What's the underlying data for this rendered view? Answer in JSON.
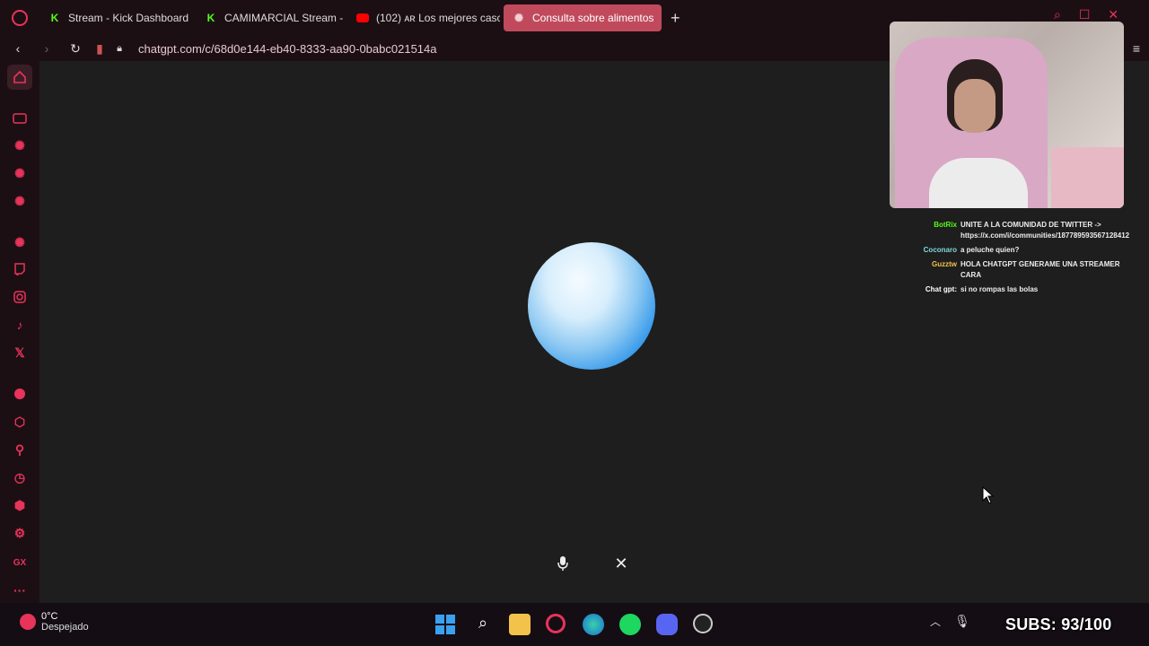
{
  "browser": {
    "tabs": [
      {
        "label": "Stream - Kick Dashboard",
        "type": "kick"
      },
      {
        "label": "CAMIMARCIAL Stream - \\",
        "type": "kick"
      },
      {
        "label": "(102) ᴀʀ Los mejores casc",
        "type": "youtube"
      },
      {
        "label": "Consulta sobre alimentos",
        "type": "chatgpt",
        "active": true
      }
    ],
    "new_tab_label": "+",
    "url": "chatgpt.com/c/68d0e144-eb40-8333-aa90-0babc021514a",
    "accent_color": "#e8335a"
  },
  "sidebar": {
    "icons": [
      "home-icon",
      "game-controller-icon",
      "chatgpt-icon",
      "chatgpt-icon",
      "chatgpt-icon",
      "chatgpt-icon",
      "twitch-icon",
      "instagram-icon",
      "tiktok-icon",
      "x-icon",
      "record-icon",
      "cube-icon",
      "pin-icon",
      "clock-icon",
      "box-icon",
      "settings-icon",
      "gx-icon",
      "more-icon"
    ],
    "gx_label": "GX",
    "more_label": "···"
  },
  "voice": {
    "orb_colors": [
      "#f4fbff",
      "#8cc8f2",
      "#1878d8"
    ]
  },
  "chat": {
    "messages": [
      {
        "user": "BotRix",
        "user_color": "#53fc18",
        "text": "UNITE A LA COMUNIDAD DE TWITTER -> https://x.com/i/communities/1877895935671284​12"
      },
      {
        "user": "Coconaro",
        "user_color": "#7fd6d9",
        "text": "a peluche quien?"
      },
      {
        "user": "Guzztw",
        "user_color": "#f0c04b",
        "text": "HOLA CHATGPT GENERAME UNA STREAMER CARA"
      },
      {
        "user": "Chat gpt:",
        "user_color": "#ffffff",
        "text": "si no rompas las bolas"
      }
    ]
  },
  "taskbar": {
    "weather_temp": "0°C",
    "weather_desc": "Despejado",
    "subs_text": "SUBS: 93/100"
  }
}
